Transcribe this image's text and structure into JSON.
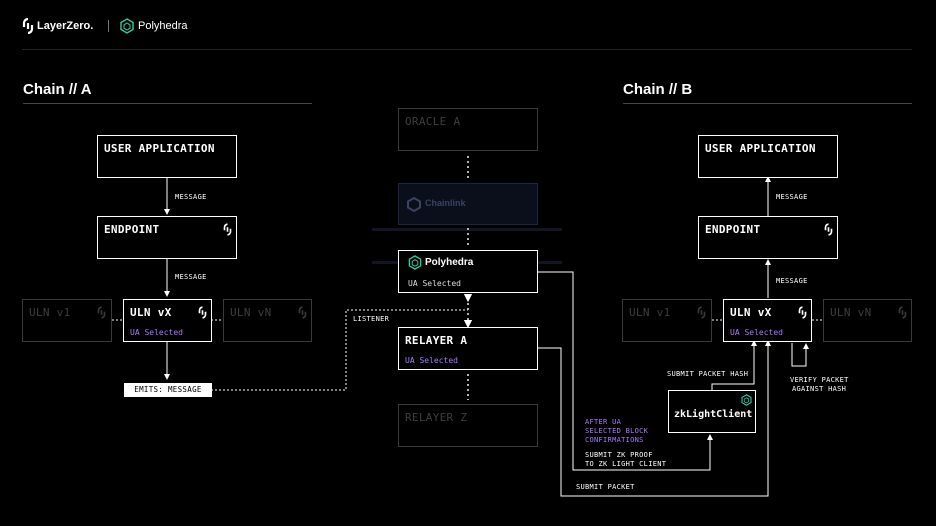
{
  "header": {
    "brand_a": "LayerZero.",
    "brand_b": "Polyhedra"
  },
  "chain_a": {
    "title": "Chain // A",
    "user_app": "USER APPLICATION",
    "message_1": "MESSAGE",
    "endpoint": "ENDPOINT",
    "message_2": "MESSAGE",
    "uln_v1": "ULN v1",
    "uln_vx": "ULN vX",
    "uln_vx_sub": "UA Selected",
    "uln_vn": "ULN vN",
    "emits": "EMITS: MESSAGE"
  },
  "middle": {
    "oracle_a": "ORACLE A",
    "chainlink": "Chainlink",
    "polyhedra": "Polyhedra",
    "polyhedra_sub": "UA Selected",
    "listener": "LISTENER",
    "relayer_a": "RELAYER A",
    "relayer_a_sub": "UA Selected",
    "relayer_z": "RELAYER Z"
  },
  "chain_b": {
    "title": "Chain // B",
    "user_app": "USER APPLICATION",
    "message_1": "MESSAGE",
    "endpoint": "ENDPOINT",
    "message_2": "MESSAGE",
    "uln_v1": "ULN v1",
    "uln_vx": "ULN vX",
    "uln_vx_sub": "UA Selected",
    "uln_vn": "ULN vN",
    "submit_packet_hash": "SUBMIT PACKET HASH",
    "verify_1": "VERIFY PACKET",
    "verify_2": "AGAINST HASH",
    "zk_client": "zkLightClient"
  },
  "flow": {
    "after_1": "AFTER UA",
    "after_2": "SELECTED BLOCK",
    "after_3": "CONFIRMATIONS",
    "submit_zk_1": "SUBMIT ZK PROOF",
    "submit_zk_2": "TO ZK LIGHT CLIENT",
    "submit_packet": "SUBMIT PACKET"
  },
  "colors": {
    "accent_purple": "#a77bff",
    "polyhedra_green": "#2fd1a4",
    "dim_border": "#3a3a3a"
  }
}
